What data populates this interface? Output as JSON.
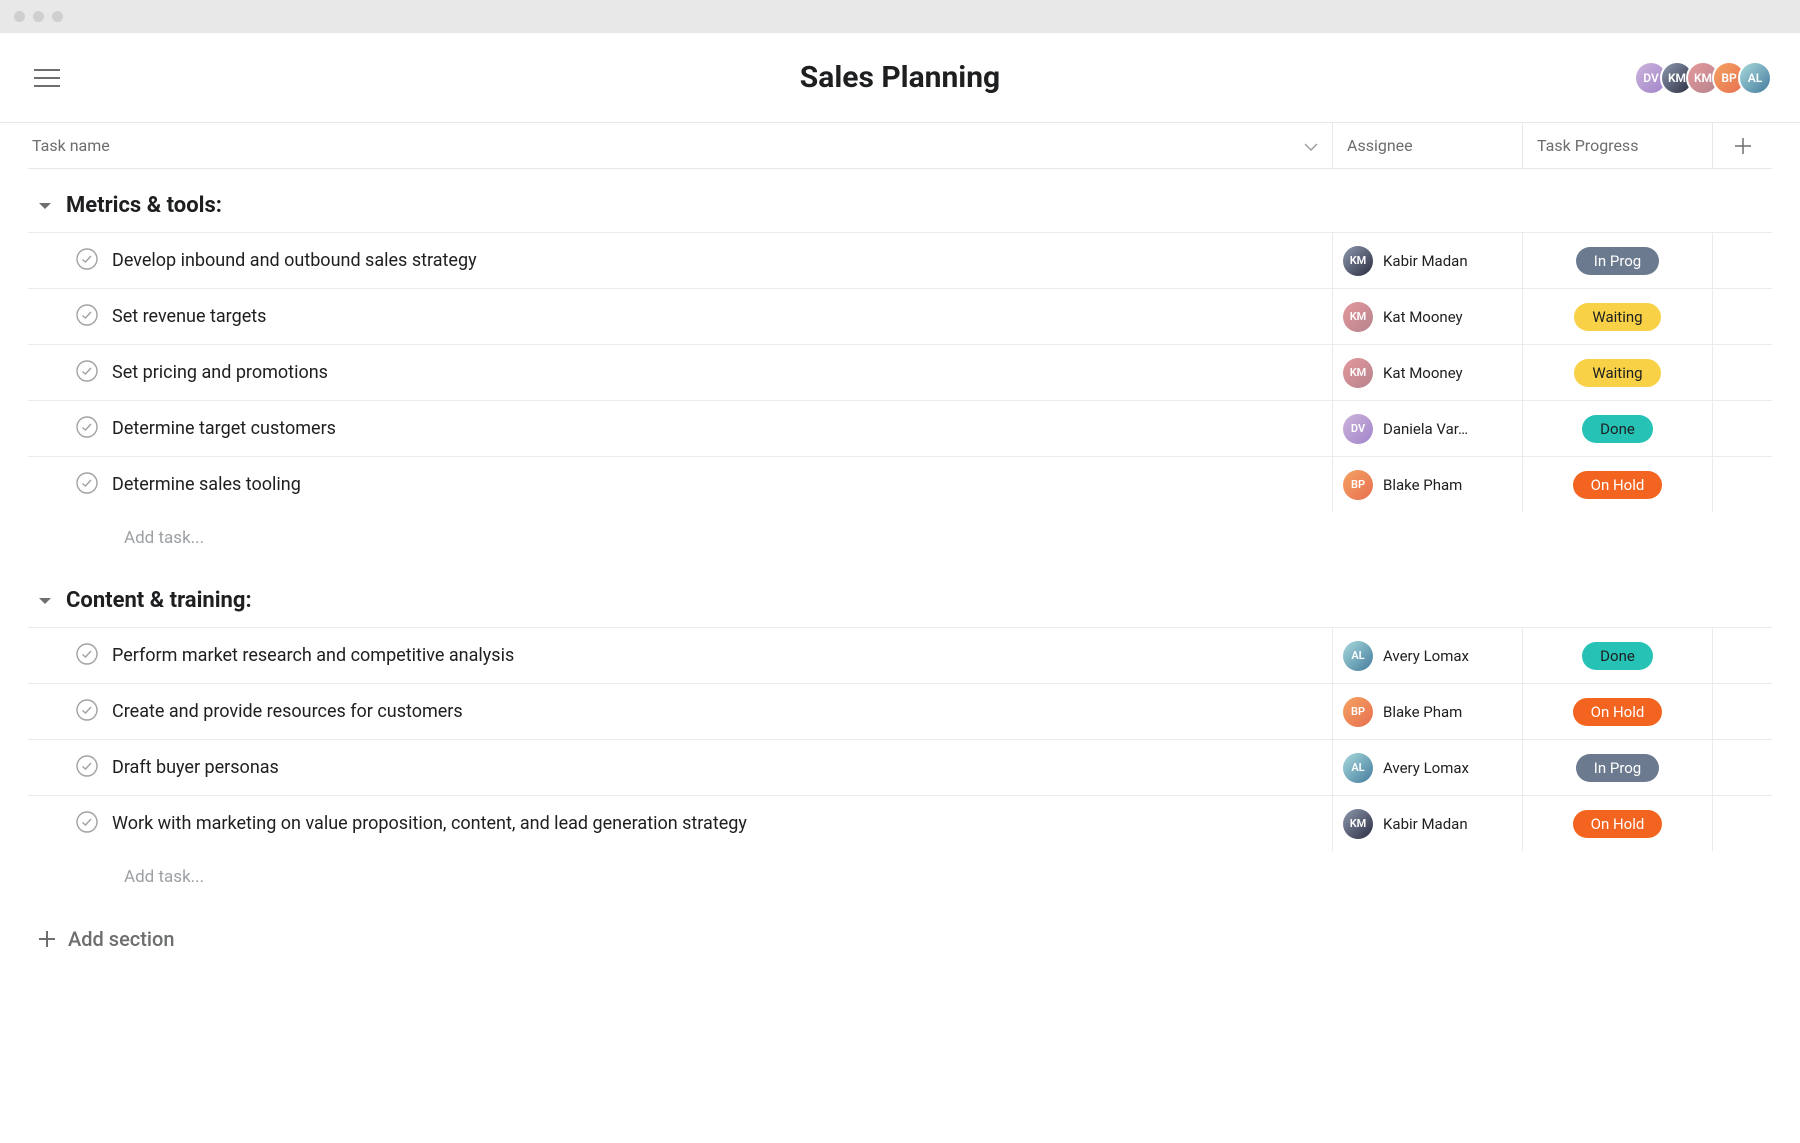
{
  "page_title": "Sales Planning",
  "columns": {
    "task_name": "Task name",
    "assignee": "Assignee",
    "progress": "Task Progress"
  },
  "header_avatars": [
    {
      "initials": "DV",
      "bg": "av-bg-5"
    },
    {
      "initials": "KM",
      "bg": "av-bg-1"
    },
    {
      "initials": "KM",
      "bg": "av-bg-2"
    },
    {
      "initials": "BP",
      "bg": "av-bg-3"
    },
    {
      "initials": "AL",
      "bg": "av-bg-4"
    }
  ],
  "sections": [
    {
      "title": "Metrics & tools:",
      "tasks": [
        {
          "title": "Develop inbound and outbound sales strategy",
          "assignee": "Kabir Madan",
          "avatar_bg": "av-bg-1",
          "status": "In Prog",
          "status_class": "status-in-prog"
        },
        {
          "title": "Set revenue targets",
          "assignee": "Kat Mooney",
          "avatar_bg": "av-bg-2",
          "status": "Waiting",
          "status_class": "status-waiting"
        },
        {
          "title": "Set pricing and promotions",
          "assignee": "Kat Mooney",
          "avatar_bg": "av-bg-2",
          "status": "Waiting",
          "status_class": "status-waiting"
        },
        {
          "title": "Determine target customers",
          "assignee": "Daniela Var…",
          "avatar_bg": "av-bg-5",
          "status": "Done",
          "status_class": "status-done"
        },
        {
          "title": "Determine sales tooling",
          "assignee": "Blake Pham",
          "avatar_bg": "av-bg-3",
          "status": "On Hold",
          "status_class": "status-on-hold"
        }
      ]
    },
    {
      "title": "Content & training:",
      "tasks": [
        {
          "title": "Perform market research and competitive analysis",
          "assignee": "Avery Lomax",
          "avatar_bg": "av-bg-4",
          "status": "Done",
          "status_class": "status-done"
        },
        {
          "title": "Create and provide resources for customers",
          "assignee": "Blake Pham",
          "avatar_bg": "av-bg-3",
          "status": "On Hold",
          "status_class": "status-on-hold"
        },
        {
          "title": "Draft buyer personas",
          "assignee": "Avery Lomax",
          "avatar_bg": "av-bg-4",
          "status": "In Prog",
          "status_class": "status-in-prog"
        },
        {
          "title": "Work with marketing on value proposition, content, and lead generation strategy",
          "assignee": "Kabir Madan",
          "avatar_bg": "av-bg-1",
          "status": "On Hold",
          "status_class": "status-on-hold"
        }
      ]
    }
  ],
  "add_task_label": "Add task...",
  "add_section_label": "Add section"
}
